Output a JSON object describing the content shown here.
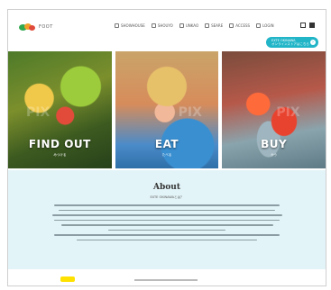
{
  "header": {
    "logo_text": "FOOT",
    "nav": [
      {
        "label": "SHOWHOUSE",
        "icon": "home-icon"
      },
      {
        "label": "SHOUYO",
        "icon": "shop-icon"
      },
      {
        "label": "UNKAO",
        "icon": "map-icon"
      },
      {
        "label": "SEARE",
        "icon": "search-icon"
      },
      {
        "label": "ACCESS",
        "icon": "pin-icon"
      },
      {
        "label": "LOGIN",
        "icon": "user-icon"
      }
    ],
    "cta_line1": "EXTE OKINAWA",
    "cta_line2": "オンラインストアはこちら"
  },
  "hero": {
    "panels": [
      {
        "label": "FIND OUT",
        "sub": "みつける"
      },
      {
        "label": "EAT",
        "sub": "たべる"
      },
      {
        "label": "BUY",
        "sub": "かう"
      }
    ],
    "watermark": "PIX"
  },
  "about": {
    "title": "About",
    "subtitle": "EXTE OKINAWAとは？"
  },
  "colors": {
    "accent": "#22b5c8",
    "about_bg": "#e3f4f8",
    "yellow": "#ffe100"
  }
}
